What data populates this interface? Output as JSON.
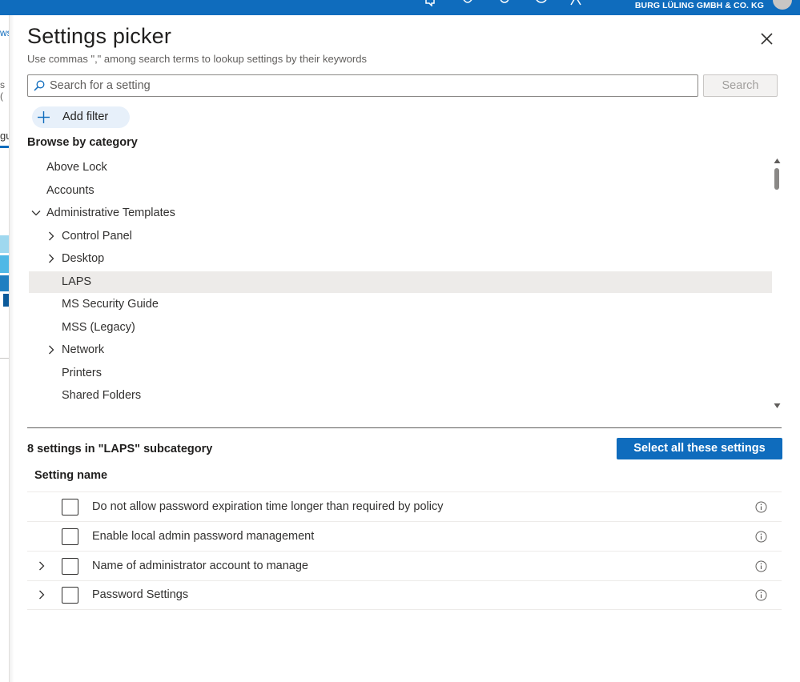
{
  "topbar": {
    "org_name": "BURG LÜLING GMBH & CO. KG",
    "icons": [
      "feedback-icon",
      "bell-icon",
      "gear-icon",
      "help-icon",
      "person-icon"
    ],
    "accent": "#0f6cbd"
  },
  "background_page": {
    "fragment_1": "ws",
    "fragment_2": "s (",
    "fragment_3": "gu"
  },
  "panel": {
    "title": "Settings picker",
    "subtitle": "Use commas \",\" among search terms to lookup settings by their keywords",
    "search": {
      "placeholder": "Search for a setting",
      "value": "",
      "button_label": "Search"
    },
    "add_filter_label": "Add filter",
    "browse_heading": "Browse by category",
    "categories": [
      {
        "label": "Above Lock",
        "level": 0,
        "chevron": "none",
        "selected": false
      },
      {
        "label": "Accounts",
        "level": 0,
        "chevron": "none",
        "selected": false
      },
      {
        "label": "Administrative Templates",
        "level": 0,
        "chevron": "down",
        "selected": false
      },
      {
        "label": "Control Panel",
        "level": 1,
        "chevron": "right",
        "selected": false
      },
      {
        "label": "Desktop",
        "level": 1,
        "chevron": "right",
        "selected": false
      },
      {
        "label": "LAPS",
        "level": 1,
        "chevron": "none",
        "selected": true
      },
      {
        "label": "MS Security Guide",
        "level": 1,
        "chevron": "none",
        "selected": false
      },
      {
        "label": "MSS (Legacy)",
        "level": 1,
        "chevron": "none",
        "selected": false
      },
      {
        "label": "Network",
        "level": 1,
        "chevron": "right",
        "selected": false
      },
      {
        "label": "Printers",
        "level": 1,
        "chevron": "none",
        "selected": false
      },
      {
        "label": "Shared Folders",
        "level": 1,
        "chevron": "none",
        "selected": false
      }
    ],
    "results": {
      "count_text": "8 settings in \"LAPS\" subcategory",
      "select_all_label": "Select all these settings",
      "column_header": "Setting name",
      "settings": [
        {
          "name": "Do not allow password expiration time longer than required by policy",
          "expandable": false,
          "checked": false
        },
        {
          "name": "Enable local admin password management",
          "expandable": false,
          "checked": false
        },
        {
          "name": "Name of administrator account to manage",
          "expandable": true,
          "checked": false
        },
        {
          "name": "Password Settings",
          "expandable": true,
          "checked": false
        }
      ]
    }
  }
}
